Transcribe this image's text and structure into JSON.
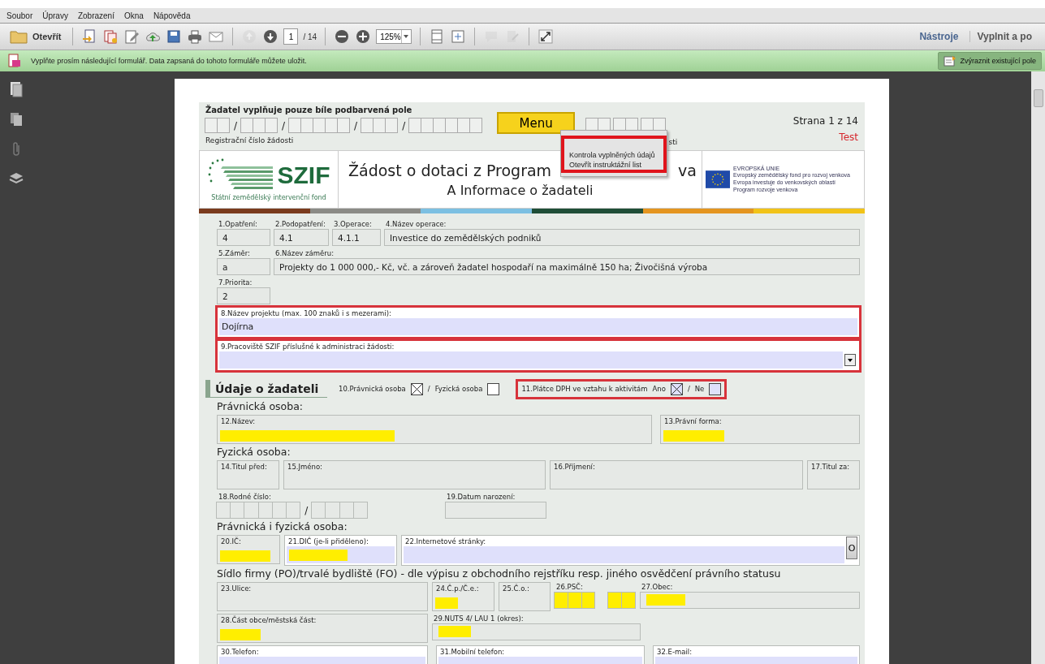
{
  "menubar": [
    "Soubor",
    "Úpravy",
    "Zobrazení",
    "Okna",
    "Nápověda"
  ],
  "toolbar": {
    "open_label": "Otevřít",
    "page": "1",
    "page_count": "/ 14",
    "zoom": "125%",
    "links": [
      {
        "label": "Nástroje",
        "selected": true
      },
      {
        "label": "Vyplnit a po",
        "selected": false
      }
    ]
  },
  "infobar": {
    "message": "Vyplňte prosím následující formulář. Data zapsaná do tohoto formuláře můžete uložit.",
    "button": "Zvýraznit existující pole"
  },
  "form": {
    "instruction": "Žadatel vyplňuje pouze bíle podbarvená pole",
    "reg_separator": "/",
    "reg_label": "Registrační číslo žádosti",
    "reg_tail": "sti",
    "menu_button": "Menu",
    "menu": {
      "flagged": true,
      "items": [
        "Kontrola vyplněných údajů",
        "Otevřít instruktážní list"
      ]
    },
    "page_label": "Strana 1 z 14",
    "mode": "Test",
    "logo": {
      "name": "SZIF",
      "subtitle": "Státní zemědělský intervenční fond"
    },
    "title_start": "Žádost o dotaci z Program",
    "title_end": "va",
    "subtitle": "A Informace o žadateli",
    "eu_text": [
      "EVROPSKÁ UNIE",
      "Evropský zemědělský fond pro rozvoj venkova",
      "Evropa investuje do venkovských oblastí",
      "Program rozvoje venkova"
    ],
    "blocks": [
      {
        "kind": "row",
        "fields": [
          {
            "kind": "value",
            "label": "1.Opatření:",
            "value": "4"
          },
          {
            "kind": "value",
            "label": "2.Podopatření:",
            "value": "4.1"
          },
          {
            "kind": "value",
            "label": "3.Operace:",
            "value": "4.1.1"
          },
          {
            "kind": "value",
            "label": "4.Název operace:",
            "value": "Investice do zemědělských podniků"
          }
        ]
      },
      {
        "kind": "row",
        "fields": [
          {
            "kind": "value",
            "label": "5.Záměr:",
            "value": "a"
          },
          {
            "kind": "value",
            "label": "6.Název záměru:",
            "value": "Projekty do 1 000 000,- Kč, vč. a zároveň žadatel hospodaří na maximálně 150 ha; Živočišná výroba"
          }
        ]
      },
      {
        "kind": "row",
        "fields": [
          {
            "kind": "value",
            "label": "7.Priorita:",
            "value": "2"
          }
        ]
      },
      {
        "kind": "row",
        "fields": [
          {
            "kind": "entry",
            "label": "8.Název projektu (max. 100 znaků i s mezerami):",
            "value": "Dojírna",
            "flagged": true
          }
        ]
      },
      {
        "kind": "row",
        "fields": [
          {
            "kind": "entry",
            "label": "9.Pracoviště SZIF příslušné k administraci žádosti:",
            "dropdown": true,
            "flagged": true
          }
        ]
      },
      {
        "kind": "applicant",
        "title": "Údaje o žadateli",
        "person": {
          "options": [
            {
              "label": "10.Právnická osoba",
              "checked": true
            },
            {
              "label": "Fyzická osoba",
              "checked": false
            }
          ],
          "separator": "/"
        },
        "vat": {
          "label": "11.Plátce DPH ve vztahu k aktivitám",
          "flagged": true,
          "separator": "/",
          "options": [
            {
              "label": "Ano",
              "checked": true
            },
            {
              "label": "Ne",
              "checked": false
            }
          ]
        }
      },
      {
        "kind": "subheading",
        "text": "Právnická osoba:"
      },
      {
        "kind": "row",
        "fields": [
          {
            "kind": "text",
            "label": "12.Název:",
            "required": true
          },
          {
            "kind": "text",
            "label": "13.Právní forma:",
            "required": true
          }
        ]
      },
      {
        "kind": "subheading",
        "text": "Fyzická osoba:"
      },
      {
        "kind": "row",
        "fields": [
          {
            "kind": "text",
            "label": "14.Titul před:"
          },
          {
            "kind": "text",
            "label": "15.Jméno:"
          },
          {
            "kind": "text",
            "label": "16.Příjmení:"
          },
          {
            "kind": "text",
            "label": "17.Titul za:"
          }
        ]
      },
      {
        "kind": "row",
        "fields": [
          {
            "kind": "segments",
            "label": "18.Rodné číslo:",
            "separator": "/"
          },
          {
            "kind": "value",
            "label": "19.Datum narození:"
          }
        ]
      },
      {
        "kind": "subheading",
        "text": "Právnická i fyzická osoba:"
      },
      {
        "kind": "row",
        "fields": [
          {
            "kind": "text",
            "label": "20.IČ:",
            "required": true
          },
          {
            "kind": "entry",
            "label": "21.DIČ (je-li přiděleno):",
            "required": true
          },
          {
            "kind": "entry",
            "label": "22.Internetové stránky:",
            "button": "O"
          }
        ]
      },
      {
        "kind": "subheading",
        "text": "Sídlo firmy (PO)/trvalé bydliště (FO) - dle výpisu z obchodního rejstříku resp. jiného osvědčení právního statusu"
      },
      {
        "kind": "row",
        "fields": [
          {
            "kind": "text",
            "label": "23.Ulice:"
          },
          {
            "kind": "text",
            "label": "24.Č.p./Č.e.:",
            "required": true
          },
          {
            "kind": "text",
            "label": "25.Č.o.:"
          },
          {
            "kind": "segments",
            "label": "26.PSČ:",
            "required": true
          },
          {
            "kind": "value",
            "label": "27.Obec:",
            "required": true
          }
        ]
      },
      {
        "kind": "row",
        "fields": [
          {
            "kind": "text",
            "label": "28.Část obce/městská část:",
            "required": true
          },
          {
            "kind": "value",
            "label": "29.NUTS 4/ LAU 1 (okres):",
            "required": true
          }
        ]
      },
      {
        "kind": "row",
        "fields": [
          {
            "kind": "entry",
            "label": "30.Telefon:"
          },
          {
            "kind": "entry",
            "label": "31.Mobilní telefon:"
          },
          {
            "kind": "entry",
            "label": "32.E-mail:"
          }
        ]
      }
    ]
  }
}
